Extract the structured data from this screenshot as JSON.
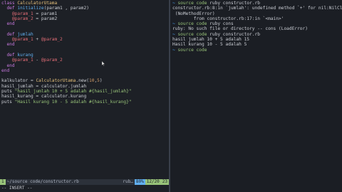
{
  "editor": {
    "lines": [
      [
        {
          "t": "class ",
          "c": "kw"
        },
        {
          "t": "CalculatorUtama",
          "c": "cls"
        }
      ],
      [
        {
          "t": "  def ",
          "c": "kw"
        },
        {
          "t": "initialize",
          "c": "fn"
        },
        {
          "t": "(param1 , param2)",
          "c": "plain"
        }
      ],
      [
        {
          "t": "    @param_1",
          "c": "var"
        },
        {
          "t": " = param1",
          "c": "plain"
        }
      ],
      [
        {
          "t": "    @param_2",
          "c": "var"
        },
        {
          "t": " = param2",
          "c": "plain"
        }
      ],
      [
        {
          "t": "  end",
          "c": "kw"
        }
      ],
      [
        {
          "t": "",
          "c": "plain"
        }
      ],
      [
        {
          "t": "  def ",
          "c": "kw"
        },
        {
          "t": "jumlah",
          "c": "fn"
        }
      ],
      [
        {
          "t": "    @param_1",
          "c": "var"
        },
        {
          "t": " + ",
          "c": "plain"
        },
        {
          "t": "@param_2",
          "c": "var"
        }
      ],
      [
        {
          "t": "  end",
          "c": "kw"
        }
      ],
      [
        {
          "t": "",
          "c": "plain"
        }
      ],
      [
        {
          "t": "  def ",
          "c": "kw"
        },
        {
          "t": "kurang",
          "c": "fn"
        }
      ],
      [
        {
          "t": "    @param_1",
          "c": "var"
        },
        {
          "t": " - ",
          "c": "plain"
        },
        {
          "t": "@param_2",
          "c": "var"
        }
      ],
      [
        {
          "t": "  end",
          "c": "kw"
        }
      ],
      [
        {
          "t": "end",
          "c": "kw"
        }
      ],
      [
        {
          "t": "",
          "c": "plain"
        }
      ],
      [
        {
          "t": "kalkulator",
          "c": "plain"
        },
        {
          "t": " = ",
          "c": "plain"
        },
        {
          "t": "CalculatorUtama",
          "c": "cls"
        },
        {
          "t": ".new(",
          "c": "plain"
        },
        {
          "t": "10",
          "c": "num"
        },
        {
          "t": ",",
          "c": "plain"
        },
        {
          "t": "5",
          "c": "num"
        },
        {
          "t": ")",
          "c": "plain"
        }
      ],
      [
        {
          "t": "hasil_jumlah",
          "c": "plain"
        },
        {
          "t": " = calculator.jumlah",
          "c": "plain"
        }
      ],
      [
        {
          "t": "puts ",
          "c": "plain"
        },
        {
          "t": "\"hasil jumlah 10 + 5 adalah #{hasil_jumlah}\"",
          "c": "str"
        }
      ],
      [
        {
          "t": "hasil_kurang",
          "c": "plain"
        },
        {
          "t": " = calculator.kurang",
          "c": "plain"
        }
      ],
      [
        {
          "t": "puts ",
          "c": "plain"
        },
        {
          "t": "\"Hasil kurang 10 - 5 adalah #{hasil_kurang}\"",
          "c": "str"
        }
      ]
    ]
  },
  "statusbar": {
    "mode_num": "1",
    "path": "~/source code/constructor.rb",
    "filetype": "rub…",
    "percent": "80%",
    "position": "12/20",
    "column": "23"
  },
  "cmdline": "-- INSERT --",
  "terminal": {
    "lines": [
      [
        {
          "t": "~ ",
          "c": "tilde"
        },
        {
          "t": "source code",
          "c": "pathc"
        },
        {
          "t": " ruby constructor.rb",
          "c": "errc"
        }
      ],
      [
        {
          "t": "constructor.rb:8:in `jumlah': undefined method `+' for nil:NilClass",
          "c": "errc"
        }
      ],
      [
        {
          "t": " (NoMethodError)",
          "c": "errc"
        }
      ],
      [
        {
          "t": "        from constructor.rb:17:in `<main>'",
          "c": "errc"
        }
      ],
      [
        {
          "t": "~ ",
          "c": "tilde"
        },
        {
          "t": "source code",
          "c": "pathc"
        },
        {
          "t": " ruby cons",
          "c": "errc"
        }
      ],
      [
        {
          "t": "ruby: No such file or directory -- cons (LoadError)",
          "c": "errc"
        }
      ],
      [
        {
          "t": "~ ",
          "c": "tilde"
        },
        {
          "t": "source code",
          "c": "pathc"
        },
        {
          "t": " ruby constructor.rb",
          "c": "errc"
        }
      ],
      [
        {
          "t": "hasil jumlah 10 + 5 adalah 15",
          "c": "errc"
        }
      ],
      [
        {
          "t": "Hasil kurang 10 - 5 adalah 5",
          "c": "errc"
        }
      ],
      [
        {
          "t": "~ ",
          "c": "tilde"
        },
        {
          "t": "source code",
          "c": "pathc"
        },
        {
          "t": " ",
          "c": "errc"
        }
      ]
    ]
  }
}
